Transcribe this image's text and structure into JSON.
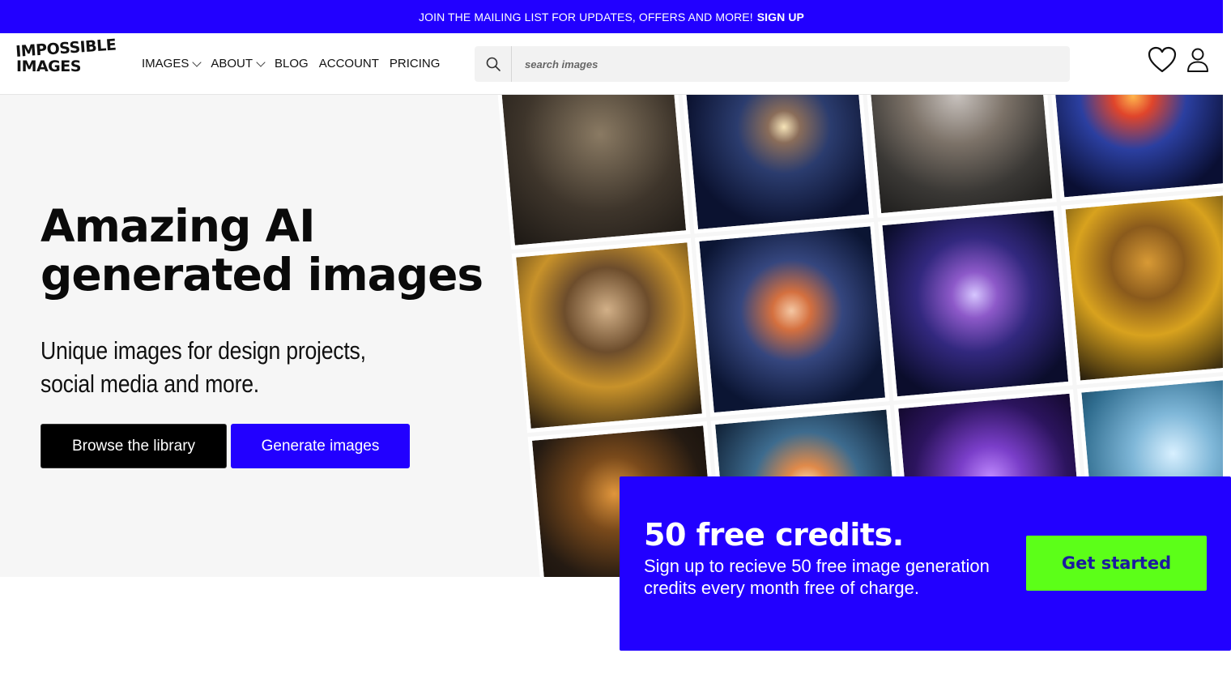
{
  "banner": {
    "text": "JOIN THE MAILING LIST FOR UPDATES, OFFERS AND MORE!",
    "link": "SIGN UP"
  },
  "header": {
    "logo": {
      "line1": "IMPOSSIBLE",
      "line2": "IMAGES"
    },
    "nav": [
      {
        "label": "IMAGES",
        "has_dropdown": true
      },
      {
        "label": "ABOUT",
        "has_dropdown": true
      },
      {
        "label": "BLOG",
        "has_dropdown": false
      },
      {
        "label": "ACCOUNT",
        "has_dropdown": false
      },
      {
        "label": "PRICING",
        "has_dropdown": false
      }
    ],
    "search": {
      "placeholder": "search images",
      "value": ""
    },
    "icons": [
      "search-icon",
      "heart-icon",
      "user-icon"
    ]
  },
  "hero": {
    "title": "Amazing AI generated images",
    "subtitle": "Unique images for design projects, social media and more.",
    "browse_button": "Browse the library",
    "generate_button": "Generate images"
  },
  "gallery": {
    "images": [
      "child-in-rope-swing",
      "spiral-galaxy",
      "grey-haired-woman-on-motorcycle",
      "colorful-galaxy",
      "man-with-bees-on-yellow-jacket",
      "nebula-orange-blue",
      "purple-galaxy",
      "bee-covered-figure-yellow-suit",
      "golden-cosmic-swirl",
      "cosmic-explosion",
      "violet-nebula",
      "icy-blue-texture"
    ]
  },
  "promo": {
    "title": "50 free credits.",
    "text": "Sign up to recieve 50 free image generation credits every month free of charge.",
    "cta": "Get started"
  },
  "colors": {
    "brand_blue": "#2200ff",
    "cta_green": "#5cff18",
    "hero_bg": "#f6f6f6"
  }
}
